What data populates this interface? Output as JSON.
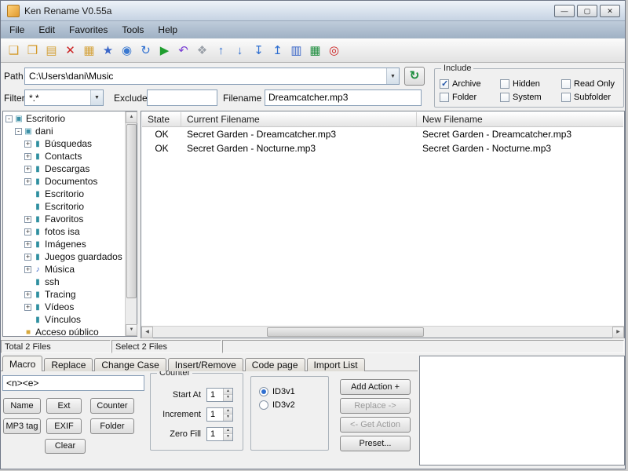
{
  "window": {
    "title": "Ken Rename V0.55a",
    "minimize": "—",
    "maximize": "▢",
    "close": "✕"
  },
  "menu": {
    "items": [
      "File",
      "Edit",
      "Favorites",
      "Tools",
      "Help"
    ]
  },
  "toolbar": {
    "icons": [
      {
        "name": "new-icon",
        "glyph": "❑",
        "color": "#d49a2a"
      },
      {
        "name": "open-folder-icon",
        "glyph": "❒",
        "color": "#d49a2a"
      },
      {
        "name": "add-folder-icon",
        "glyph": "▤",
        "color": "#d4a23a"
      },
      {
        "name": "delete-icon",
        "glyph": "✕",
        "color": "#cc2222"
      },
      {
        "name": "browse-folder-icon",
        "glyph": "▦",
        "color": "#d4a23a"
      },
      {
        "name": "favorites-icon",
        "glyph": "★",
        "color": "#3a66c8"
      },
      {
        "name": "preview-icon",
        "glyph": "◉",
        "color": "#3a78d0"
      },
      {
        "name": "refresh-icon",
        "glyph": "↻",
        "color": "#2f6fd0"
      },
      {
        "name": "run-rename-icon",
        "glyph": "▶",
        "color": "#1f9e2f"
      },
      {
        "name": "undo-icon",
        "glyph": "↶",
        "color": "#7a3fd4"
      },
      {
        "name": "window-icon",
        "glyph": "❖",
        "color": "#9aa0a8"
      },
      {
        "name": "move-up-icon",
        "glyph": "↑",
        "color": "#2f6fd0"
      },
      {
        "name": "move-down-icon",
        "glyph": "↓",
        "color": "#2f6fd0"
      },
      {
        "name": "move-bottom-icon",
        "glyph": "↧",
        "color": "#2f6fd0"
      },
      {
        "name": "move-top-icon",
        "glyph": "↥",
        "color": "#2f6fd0"
      },
      {
        "name": "grid-icon",
        "glyph": "▥",
        "color": "#3a66c8"
      },
      {
        "name": "excel-export-icon",
        "glyph": "▦",
        "color": "#1f8e3f"
      },
      {
        "name": "exit-icon",
        "glyph": "◎",
        "color": "#cc2222"
      }
    ]
  },
  "path_row": {
    "label": "Path",
    "value": "C:\\Users\\dani\\Music",
    "browse_glyph": "↻"
  },
  "include": {
    "title": "Include",
    "options": [
      {
        "label": "Archive",
        "checked": true
      },
      {
        "label": "Hidden",
        "checked": false
      },
      {
        "label": "Read Only",
        "checked": false
      },
      {
        "label": "Folder",
        "checked": false
      },
      {
        "label": "System",
        "checked": false
      },
      {
        "label": "Subfolder",
        "checked": false
      }
    ]
  },
  "filter_row": {
    "filter_label": "Filter",
    "filter_value": "*.*",
    "exclude_label": "Exclude",
    "exclude_value": "",
    "filename_label": "Filename",
    "filename_value": "Dreamcatcher.mp3"
  },
  "tree": {
    "items": [
      {
        "label": "Escritorio",
        "level": 0,
        "expand": "-",
        "icon_glyph": "▣",
        "icon_color": "#3b8fa6"
      },
      {
        "label": "dani",
        "level": 1,
        "expand": "-",
        "icon_glyph": "▣",
        "icon_color": "#3b8fa6"
      },
      {
        "label": "Búsquedas",
        "level": 2,
        "expand": "+",
        "icon_glyph": "▮",
        "icon_color": "#2e8fa0"
      },
      {
        "label": "Contacts",
        "level": 2,
        "expand": "+",
        "icon_glyph": "▮",
        "icon_color": "#2e8fa0"
      },
      {
        "label": "Descargas",
        "level": 2,
        "expand": "+",
        "icon_glyph": "▮",
        "icon_color": "#2e8fa0"
      },
      {
        "label": "Documentos",
        "level": 2,
        "expand": "+",
        "icon_glyph": "▮",
        "icon_color": "#2e8fa0"
      },
      {
        "label": "Escritorio",
        "level": 2,
        "expand": "",
        "icon_glyph": "▮",
        "icon_color": "#2e8fa0"
      },
      {
        "label": "Escritorio",
        "level": 2,
        "expand": "",
        "icon_glyph": "▮",
        "icon_color": "#2e8fa0"
      },
      {
        "label": "Favoritos",
        "level": 2,
        "expand": "+",
        "icon_glyph": "▮",
        "icon_color": "#2e8fa0"
      },
      {
        "label": "fotos isa",
        "level": 2,
        "expand": "+",
        "icon_glyph": "▮",
        "icon_color": "#2e8fa0"
      },
      {
        "label": "Imágenes",
        "level": 2,
        "expand": "+",
        "icon_glyph": "▮",
        "icon_color": "#2e8fa0"
      },
      {
        "label": "Juegos guardados",
        "level": 2,
        "expand": "+",
        "icon_glyph": "▮",
        "icon_color": "#2e8fa0"
      },
      {
        "label": "Música",
        "level": 2,
        "expand": "+",
        "icon_glyph": "♪",
        "icon_color": "#3a66c8"
      },
      {
        "label": "ssh",
        "level": 2,
        "expand": "",
        "icon_glyph": "▮",
        "icon_color": "#2e8fa0"
      },
      {
        "label": "Tracing",
        "level": 2,
        "expand": "+",
        "icon_glyph": "▮",
        "icon_color": "#2e8fa0"
      },
      {
        "label": "Vídeos",
        "level": 2,
        "expand": "+",
        "icon_glyph": "▮",
        "icon_color": "#2e8fa0"
      },
      {
        "label": "Vínculos",
        "level": 2,
        "expand": "",
        "icon_glyph": "▮",
        "icon_color": "#2e8fa0"
      },
      {
        "label": "Acceso público",
        "level": 1,
        "expand": "",
        "icon_glyph": "■",
        "icon_color": "#d8a93c"
      }
    ]
  },
  "table": {
    "columns": [
      "State",
      "Current Filename",
      "New Filename"
    ],
    "rows": [
      [
        "OK",
        "Secret Garden - Dreamcatcher.mp3",
        "Secret Garden - Dreamcatcher.mp3"
      ],
      [
        "OK",
        "Secret Garden - Nocturne.mp3",
        "Secret Garden - Nocturne.mp3"
      ]
    ]
  },
  "status": {
    "total": "Total 2 Files",
    "select": "Select 2 Files"
  },
  "tabs": {
    "items": [
      {
        "label": "Macro",
        "active": true
      },
      {
        "label": "Replace",
        "active": false
      },
      {
        "label": "Change Case",
        "active": false
      },
      {
        "label": "Insert/Remove",
        "active": false
      },
      {
        "label": "Code page",
        "active": false
      },
      {
        "label": "Import List",
        "active": false
      }
    ]
  },
  "macro": {
    "pattern": "<n><e>",
    "buttons": [
      "Name",
      "Ext",
      "Counter",
      "MP3 tag",
      "EXIF",
      "Folder",
      "Clear"
    ]
  },
  "counter": {
    "title": "Counter",
    "fields": [
      {
        "label": "Start At",
        "value": "1"
      },
      {
        "label": "Increment",
        "value": "1"
      },
      {
        "label": "Zero Fill",
        "value": "1"
      }
    ]
  },
  "id3": {
    "options": [
      {
        "label": "ID3v1",
        "selected": true
      },
      {
        "label": "ID3v2",
        "selected": false
      }
    ]
  },
  "actions": {
    "buttons": [
      {
        "label": "Add Action +",
        "enabled": true
      },
      {
        "label": "Replace ->",
        "enabled": false
      },
      {
        "label": "<- Get Action",
        "enabled": false
      },
      {
        "label": "Preset...",
        "enabled": true
      }
    ]
  },
  "ui": {
    "dropdown_arrow": "▼",
    "spin_up": "▲",
    "spin_down": "▼",
    "scroll_up": "▲",
    "scroll_down": "▼",
    "scroll_left": "◀",
    "scroll_right": "▶"
  }
}
